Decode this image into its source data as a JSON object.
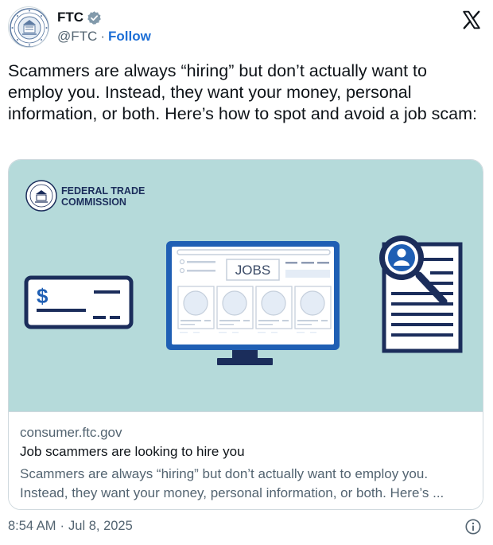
{
  "account": {
    "name": "FTC",
    "handle": "@FTC",
    "separator": "·",
    "follow_label": "Follow",
    "verified_color": "#829aab"
  },
  "tweet": {
    "text": "Scammers are always “hiring” but don’t actually want to employ you. Instead, they want your money, personal information, or both. Here’s how to spot and avoid a job scam:"
  },
  "card": {
    "image": {
      "logo_line1": "FEDERAL TRADE",
      "logo_line2": "COMMISSION",
      "jobs_label": "JOBS",
      "dollar_sign": "$",
      "background_color": "#b5dada",
      "navy_color": "#1b2d5b",
      "blue_color": "#1f5fb4"
    },
    "domain": "consumer.ftc.gov",
    "title": "Job scammers are looking to hire you",
    "description": "Scammers are always “hiring” but don’t actually want to employ you. Instead, they want your money, personal information, or both. Here’s ..."
  },
  "footer": {
    "time": "8:54 AM",
    "separator": "·",
    "date": "Jul 8, 2025"
  },
  "icons": {
    "platform": "x-logo-icon",
    "verified": "verified-badge-icon",
    "info": "info-icon"
  }
}
